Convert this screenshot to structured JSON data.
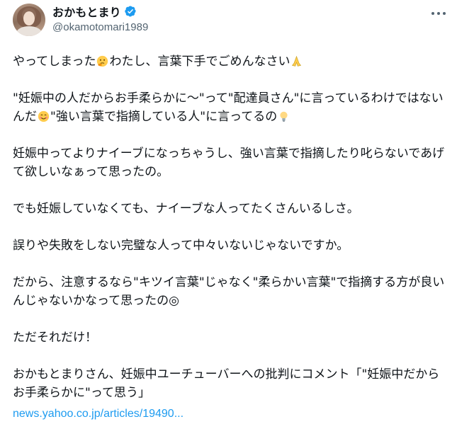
{
  "author": {
    "display_name": "おかもとまり",
    "handle": "@okamotomari1989",
    "verified": true
  },
  "icons": {
    "verified": "verified-badge-icon",
    "more": "more-options-icon",
    "emoji_thinking": "thinking-face-emoji",
    "emoji_pray": "folded-hands-emoji",
    "emoji_smile": "smiling-face-emoji",
    "emoji_bulb": "light-bulb-emoji"
  },
  "colors": {
    "link": "#1d9bf0",
    "verified": "#1d9bf0",
    "secondary_text": "#536471"
  },
  "tweet": {
    "p1_a": "やってしまった",
    "p1_b": "わたし、言葉下手でごめんなさい",
    "p2_a": "\"妊娠中の人だからお手柔らかに〜\"って\"配達員さん\"に言っているわけではないんだ",
    "p2_b": "\"強い言葉で指摘している人\"に言ってるの",
    "p3": "妊娠中ってよりナイーブになっちゃうし、強い言葉で指摘したり叱らないであげて欲しいなぁって思ったの。",
    "p4": "でも妊娠していなくても、ナイーブな人ってたくさんいるしさ。",
    "p5": "誤りや失敗をしない完璧な人って中々いないじゃないですか。",
    "p6": "だから、注意するなら\"キツイ言葉\"じゃなく\"柔らかい言葉\"で指摘する方が良いんじゃないかなって思ったの◎",
    "p7": "ただそれだけ！",
    "p8": "おかもとまりさん、妊娠中ユーチューバーへの批判にコメント「\"妊娠中だからお手柔らかに\"って思う」",
    "link_text": "news.yahoo.co.jp/articles/19490..."
  }
}
